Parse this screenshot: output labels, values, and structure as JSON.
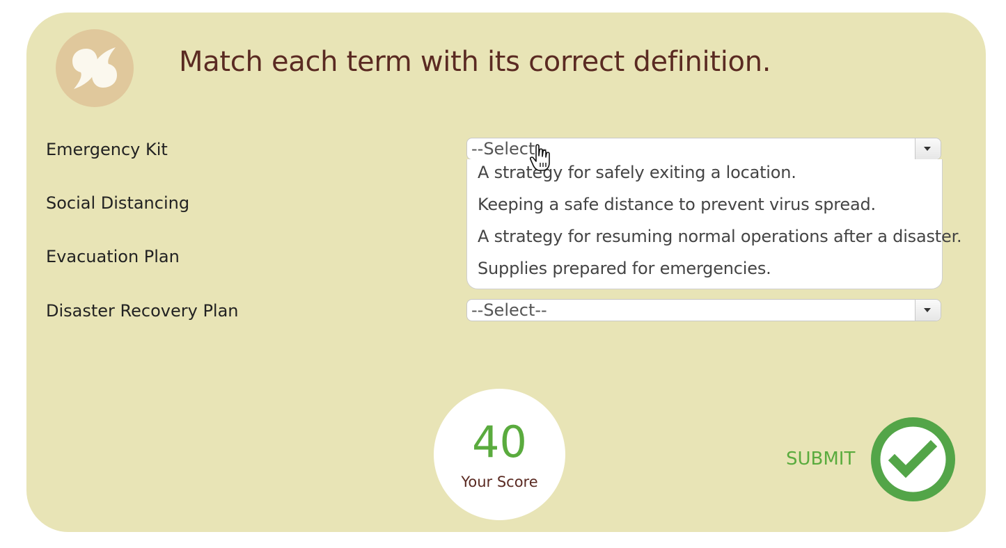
{
  "header": {
    "title": "Match each term with its correct definition.",
    "logo_icon": "quote-icon"
  },
  "terms": [
    {
      "label": "Emergency Kit",
      "selected": "--Select--",
      "open": true
    },
    {
      "label": "Social Distancing"
    },
    {
      "label": "Evacuation Plan"
    },
    {
      "label": "Disaster Recovery Plan",
      "selected": "--Select--",
      "open": false
    }
  ],
  "dropdown": {
    "options": [
      "A strategy for safely exiting a location.",
      "Keeping a safe distance to prevent virus spread.",
      "A strategy for resuming normal operations after a disaster.",
      "Supplies prepared for emergencies."
    ]
  },
  "score": {
    "value": "40",
    "label": "Your Score"
  },
  "submit": {
    "label": "SUBMIT",
    "icon": "checkmark-icon"
  },
  "colors": {
    "card_bg": "#e8e4b6",
    "title": "#5a2a22",
    "accent_green": "#5aab3e",
    "logo_bg": "#e0c89c"
  }
}
